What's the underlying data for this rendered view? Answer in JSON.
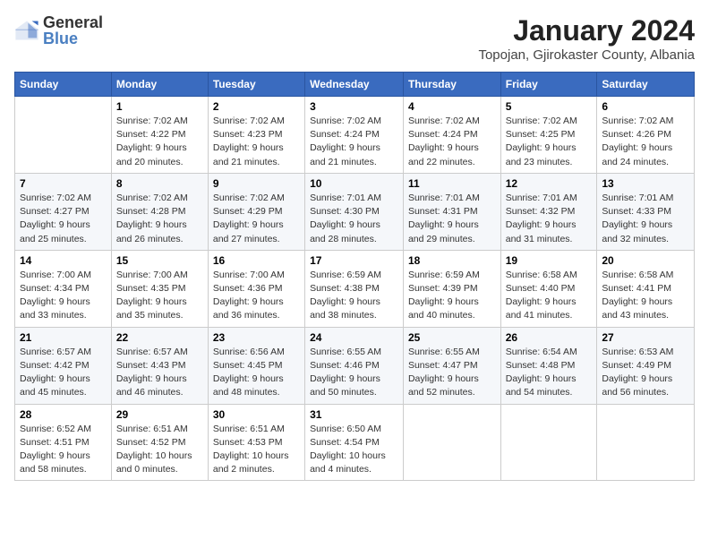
{
  "logo": {
    "text1": "General",
    "text2": "Blue"
  },
  "title": "January 2024",
  "subtitle": "Topojan, Gjirokaster County, Albania",
  "days_of_week": [
    "Sunday",
    "Monday",
    "Tuesday",
    "Wednesday",
    "Thursday",
    "Friday",
    "Saturday"
  ],
  "weeks": [
    [
      {
        "day": "",
        "info": ""
      },
      {
        "day": "1",
        "info": "Sunrise: 7:02 AM\nSunset: 4:22 PM\nDaylight: 9 hours\nand 20 minutes."
      },
      {
        "day": "2",
        "info": "Sunrise: 7:02 AM\nSunset: 4:23 PM\nDaylight: 9 hours\nand 21 minutes."
      },
      {
        "day": "3",
        "info": "Sunrise: 7:02 AM\nSunset: 4:24 PM\nDaylight: 9 hours\nand 21 minutes."
      },
      {
        "day": "4",
        "info": "Sunrise: 7:02 AM\nSunset: 4:24 PM\nDaylight: 9 hours\nand 22 minutes."
      },
      {
        "day": "5",
        "info": "Sunrise: 7:02 AM\nSunset: 4:25 PM\nDaylight: 9 hours\nand 23 minutes."
      },
      {
        "day": "6",
        "info": "Sunrise: 7:02 AM\nSunset: 4:26 PM\nDaylight: 9 hours\nand 24 minutes."
      }
    ],
    [
      {
        "day": "7",
        "info": "Sunrise: 7:02 AM\nSunset: 4:27 PM\nDaylight: 9 hours\nand 25 minutes."
      },
      {
        "day": "8",
        "info": "Sunrise: 7:02 AM\nSunset: 4:28 PM\nDaylight: 9 hours\nand 26 minutes."
      },
      {
        "day": "9",
        "info": "Sunrise: 7:02 AM\nSunset: 4:29 PM\nDaylight: 9 hours\nand 27 minutes."
      },
      {
        "day": "10",
        "info": "Sunrise: 7:01 AM\nSunset: 4:30 PM\nDaylight: 9 hours\nand 28 minutes."
      },
      {
        "day": "11",
        "info": "Sunrise: 7:01 AM\nSunset: 4:31 PM\nDaylight: 9 hours\nand 29 minutes."
      },
      {
        "day": "12",
        "info": "Sunrise: 7:01 AM\nSunset: 4:32 PM\nDaylight: 9 hours\nand 31 minutes."
      },
      {
        "day": "13",
        "info": "Sunrise: 7:01 AM\nSunset: 4:33 PM\nDaylight: 9 hours\nand 32 minutes."
      }
    ],
    [
      {
        "day": "14",
        "info": "Sunrise: 7:00 AM\nSunset: 4:34 PM\nDaylight: 9 hours\nand 33 minutes."
      },
      {
        "day": "15",
        "info": "Sunrise: 7:00 AM\nSunset: 4:35 PM\nDaylight: 9 hours\nand 35 minutes."
      },
      {
        "day": "16",
        "info": "Sunrise: 7:00 AM\nSunset: 4:36 PM\nDaylight: 9 hours\nand 36 minutes."
      },
      {
        "day": "17",
        "info": "Sunrise: 6:59 AM\nSunset: 4:38 PM\nDaylight: 9 hours\nand 38 minutes."
      },
      {
        "day": "18",
        "info": "Sunrise: 6:59 AM\nSunset: 4:39 PM\nDaylight: 9 hours\nand 40 minutes."
      },
      {
        "day": "19",
        "info": "Sunrise: 6:58 AM\nSunset: 4:40 PM\nDaylight: 9 hours\nand 41 minutes."
      },
      {
        "day": "20",
        "info": "Sunrise: 6:58 AM\nSunset: 4:41 PM\nDaylight: 9 hours\nand 43 minutes."
      }
    ],
    [
      {
        "day": "21",
        "info": "Sunrise: 6:57 AM\nSunset: 4:42 PM\nDaylight: 9 hours\nand 45 minutes."
      },
      {
        "day": "22",
        "info": "Sunrise: 6:57 AM\nSunset: 4:43 PM\nDaylight: 9 hours\nand 46 minutes."
      },
      {
        "day": "23",
        "info": "Sunrise: 6:56 AM\nSunset: 4:45 PM\nDaylight: 9 hours\nand 48 minutes."
      },
      {
        "day": "24",
        "info": "Sunrise: 6:55 AM\nSunset: 4:46 PM\nDaylight: 9 hours\nand 50 minutes."
      },
      {
        "day": "25",
        "info": "Sunrise: 6:55 AM\nSunset: 4:47 PM\nDaylight: 9 hours\nand 52 minutes."
      },
      {
        "day": "26",
        "info": "Sunrise: 6:54 AM\nSunset: 4:48 PM\nDaylight: 9 hours\nand 54 minutes."
      },
      {
        "day": "27",
        "info": "Sunrise: 6:53 AM\nSunset: 4:49 PM\nDaylight: 9 hours\nand 56 minutes."
      }
    ],
    [
      {
        "day": "28",
        "info": "Sunrise: 6:52 AM\nSunset: 4:51 PM\nDaylight: 9 hours\nand 58 minutes."
      },
      {
        "day": "29",
        "info": "Sunrise: 6:51 AM\nSunset: 4:52 PM\nDaylight: 10 hours\nand 0 minutes."
      },
      {
        "day": "30",
        "info": "Sunrise: 6:51 AM\nSunset: 4:53 PM\nDaylight: 10 hours\nand 2 minutes."
      },
      {
        "day": "31",
        "info": "Sunrise: 6:50 AM\nSunset: 4:54 PM\nDaylight: 10 hours\nand 4 minutes."
      },
      {
        "day": "",
        "info": ""
      },
      {
        "day": "",
        "info": ""
      },
      {
        "day": "",
        "info": ""
      }
    ]
  ]
}
